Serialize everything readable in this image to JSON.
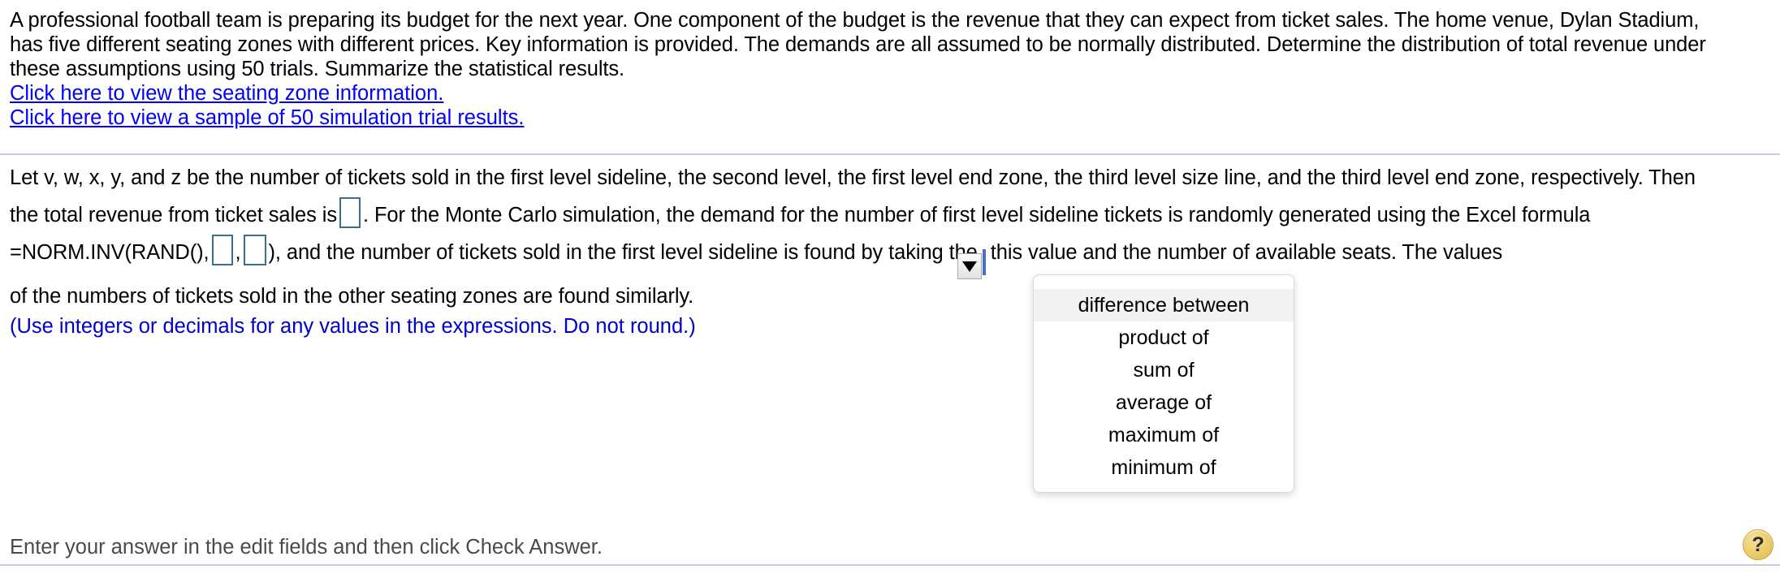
{
  "problem": {
    "statement_lines": [
      "A professional football team is preparing its budget for the next year. One component of the budget is the revenue that they can expect from ticket sales. The home venue, Dylan Stadium,",
      "has five different seating zones with different prices. Key information is provided. The demands are all assumed to be normally distributed. Determine the distribution of total revenue under",
      "these assumptions using 50 trials. Summarize the statistical results."
    ],
    "links": [
      "Click here to view the seating zone information.",
      "Click here to view a sample of 50 simulation trial results."
    ]
  },
  "answer": {
    "line1": "Let v, w, x, y, and z be the number of tickets sold in the first level sideline, the second level, the first level end zone, the third level size line, and the third level end zone, respectively. Then",
    "line2_before": "the total revenue from ticket sales is",
    "line2_after": ". For the Monte Carlo simulation, the demand for the number of first level sideline tickets is randomly generated using the Excel formula",
    "line3_formula_start": "=NORM.INV(RAND(),",
    "line3_comma": ",",
    "line3_formula_end": "), and the number of tickets sold in the first level sideline is found by taking the",
    "line3_after_combo": "this value and the number of available seats. The values",
    "line4": "of the numbers of tickets sold in the other seating zones are found similarly.",
    "note": "(Use integers or decimals for any values in the expressions. Do not round.)",
    "field_values": {
      "total_revenue": "",
      "norminv_mean": "",
      "norminv_stdev": ""
    }
  },
  "combobox": {
    "selected_value": "",
    "arrow_icon": "chevron-down-icon",
    "options": [
      "difference between",
      "product of",
      "sum of",
      "average of",
      "maximum of",
      "minimum of"
    ],
    "highlighted_option": "difference between"
  },
  "footer": {
    "hint": "Enter your answer in the edit fields and then click Check Answer.",
    "help_label": "?",
    "help_icon": "question-mark-icon"
  },
  "colors": {
    "link": "#0000ff",
    "note": "#0000cc",
    "field_border": "#3d6e8e",
    "combo_border": "#4a6fc4",
    "rule": "#c9cede",
    "help_button": "#eecf72"
  }
}
